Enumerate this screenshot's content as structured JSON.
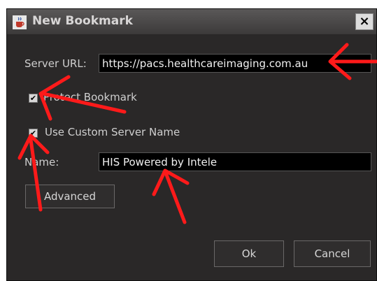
{
  "dialog": {
    "title": "New Bookmark",
    "close_glyph": "×"
  },
  "form": {
    "server_url_label": "Server URL:",
    "server_url_value": "https://pacs.healthcareimaging.com.au",
    "protect_bookmark_label": "Protect Bookmark",
    "protect_bookmark_checked": true,
    "use_custom_name_label": "Use Custom Server Name",
    "use_custom_name_checked": true,
    "name_label": "Name:",
    "name_value": "HIS Powered by Intele"
  },
  "buttons": {
    "advanced": "Advanced",
    "ok": "Ok",
    "cancel": "Cancel"
  },
  "icons": {
    "app": "java-coffee-icon",
    "check_glyph": "✔"
  },
  "colors": {
    "annotation_arrow": "#ff1a1a",
    "dialog_bg": "#2a2828"
  }
}
